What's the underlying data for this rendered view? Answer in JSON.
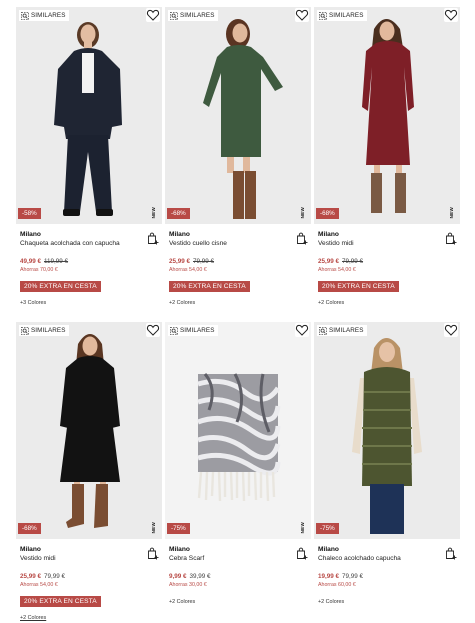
{
  "labels": {
    "similares": "SIMILARES",
    "new": "NEW"
  },
  "colors": {
    "accent": "#b84a46",
    "photo_bg": "#ebebeb"
  },
  "products": [
    {
      "brand": "Milano",
      "name": "Chaqueta acolchada con capucha",
      "discount": "-58%",
      "price": "49,99 €",
      "old_price": "119,99 €",
      "old_struck": true,
      "saving": "Ahorras 70,00 €",
      "extra": "20% EXTRA EN CESTA",
      "colors": "+3 Colores",
      "new": true,
      "icon": "puffer-jacket-outfit"
    },
    {
      "brand": "Milano",
      "name": "Vestido cuello cisne",
      "discount": "-68%",
      "price": "25,99 €",
      "old_price": "79,99 €",
      "old_struck": true,
      "saving": "Ahorras 54,00 €",
      "extra": "20% EXTRA EN CESTA",
      "colors": "+2 Colores",
      "new": true,
      "icon": "green-knit-dress"
    },
    {
      "brand": "Milano",
      "name": "Vestido midi",
      "discount": "-68%",
      "price": "25,99 €",
      "old_price": "79,99 €",
      "old_struck": true,
      "saving": "Ahorras 54,00 €",
      "extra": "20% EXTRA EN CESTA",
      "colors": "+2 Colores",
      "new": true,
      "icon": "burgundy-midi-dress"
    },
    {
      "brand": "Milano",
      "name": "Vestido midi",
      "discount": "-68%",
      "price": "25,99 €",
      "old_price": "79,99 €",
      "old_struck": false,
      "saving": "Ahorras 54,00 €",
      "extra": "20% EXTRA EN CESTA",
      "colors": "+2 Colores",
      "new": true,
      "icon": "black-midi-dress"
    },
    {
      "brand": "Milano",
      "name": "Cebra Scarf",
      "discount": "-75%",
      "price": "9,99 €",
      "old_price": "39,99 €",
      "old_struck": false,
      "saving": "Ahorras 30,00 €",
      "extra": "",
      "colors": "+2 Colores",
      "new": true,
      "icon": "zebra-scarf"
    },
    {
      "brand": "Milano",
      "name": "Chaleco acolchado capucha",
      "discount": "-75%",
      "price": "19,99 €",
      "old_price": "79,99 €",
      "old_struck": false,
      "saving": "Ahorras 60,00 €",
      "extra": "",
      "colors": "+2 Colores",
      "new": false,
      "icon": "puffer-vest-outfit"
    }
  ]
}
